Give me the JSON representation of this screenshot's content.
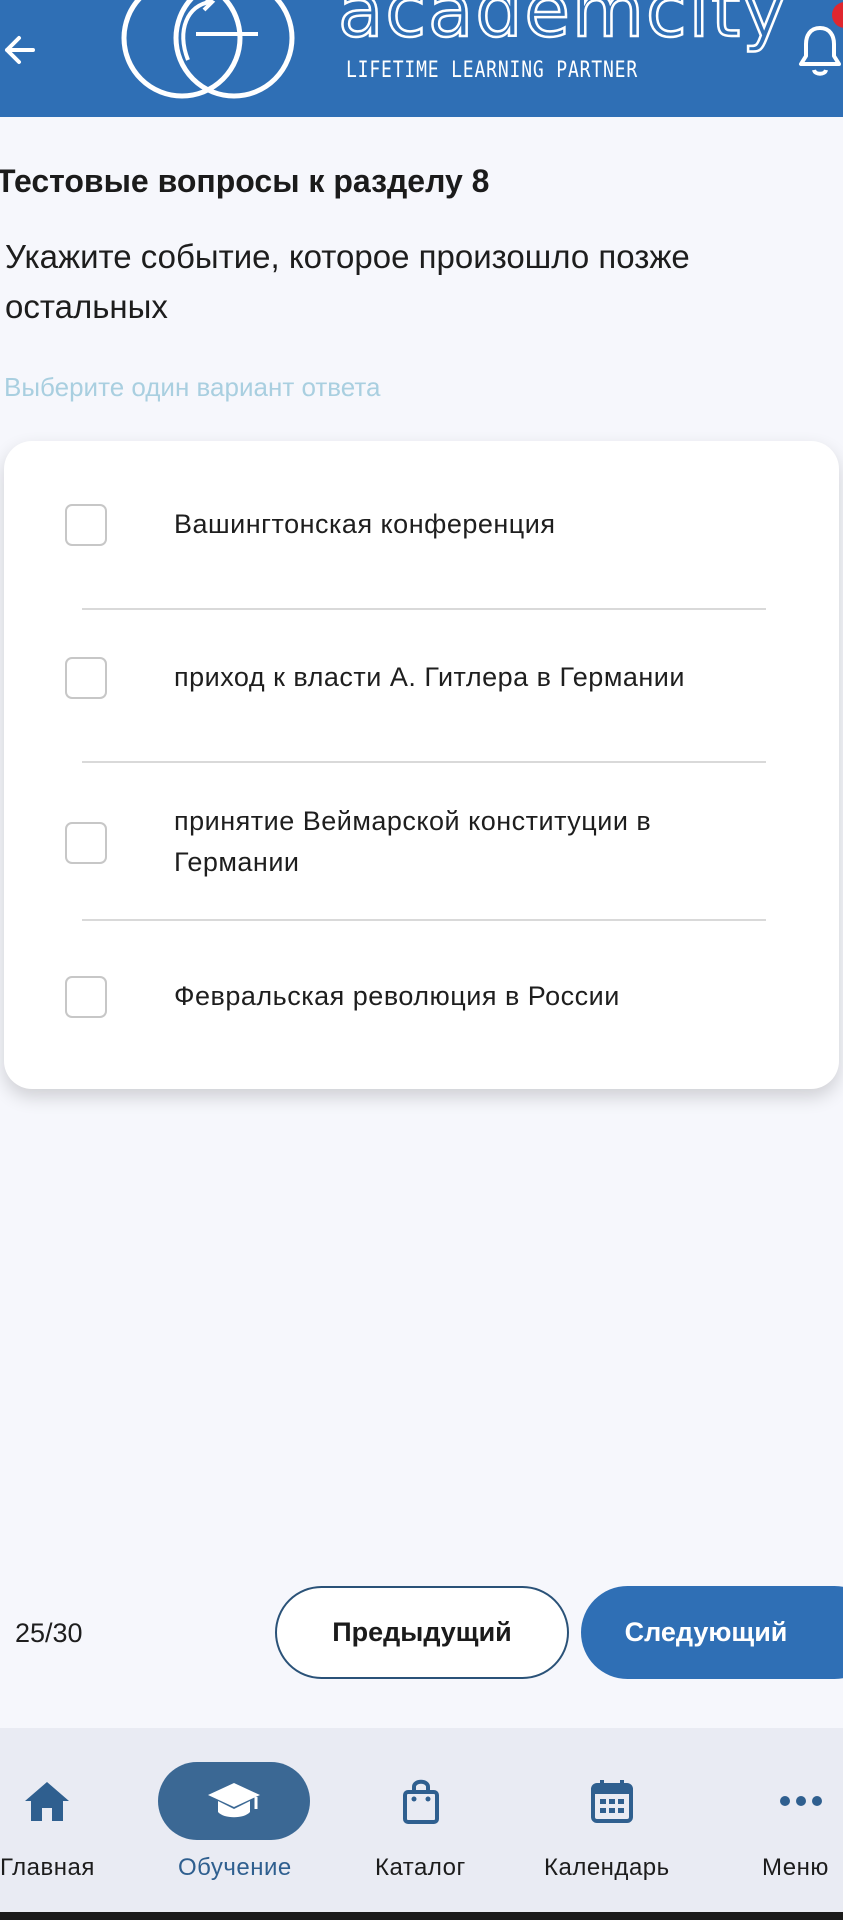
{
  "header": {
    "logo_text": "academcity",
    "tagline": "LIFETIME LEARNING PARTNER"
  },
  "quiz": {
    "section_title": "Тестовые вопросы к разделу 8",
    "question": "Укажите событие, которое произошло позже остальных",
    "hint": "Выберите один вариант ответа",
    "options": [
      {
        "label": "Вашингтонская конференция",
        "checked": false
      },
      {
        "label": "приход к власти А. Гитлера в Германии",
        "checked": false
      },
      {
        "label": "принятие Веймарской конституции в Германии",
        "checked": false
      },
      {
        "label": "Февральская революция в России",
        "checked": false
      }
    ]
  },
  "pager": {
    "counter": "25/30",
    "prev_label": "Предыдущий",
    "next_label": "Следующий"
  },
  "nav": {
    "items": [
      {
        "label": "Главная",
        "icon": "home-icon",
        "active": false
      },
      {
        "label": "Обучение",
        "icon": "graduation-cap-icon",
        "active": true
      },
      {
        "label": "Каталог",
        "icon": "shopping-bag-icon",
        "active": false
      },
      {
        "label": "Календарь",
        "icon": "calendar-icon",
        "active": false
      },
      {
        "label": "Меню",
        "icon": "more-dots-icon",
        "active": false
      }
    ]
  },
  "colors": {
    "brand_blue": "#2f6fb5",
    "nav_active": "#3b6894",
    "badge_red": "#e0262e",
    "hint_text": "#a9cfe0"
  }
}
